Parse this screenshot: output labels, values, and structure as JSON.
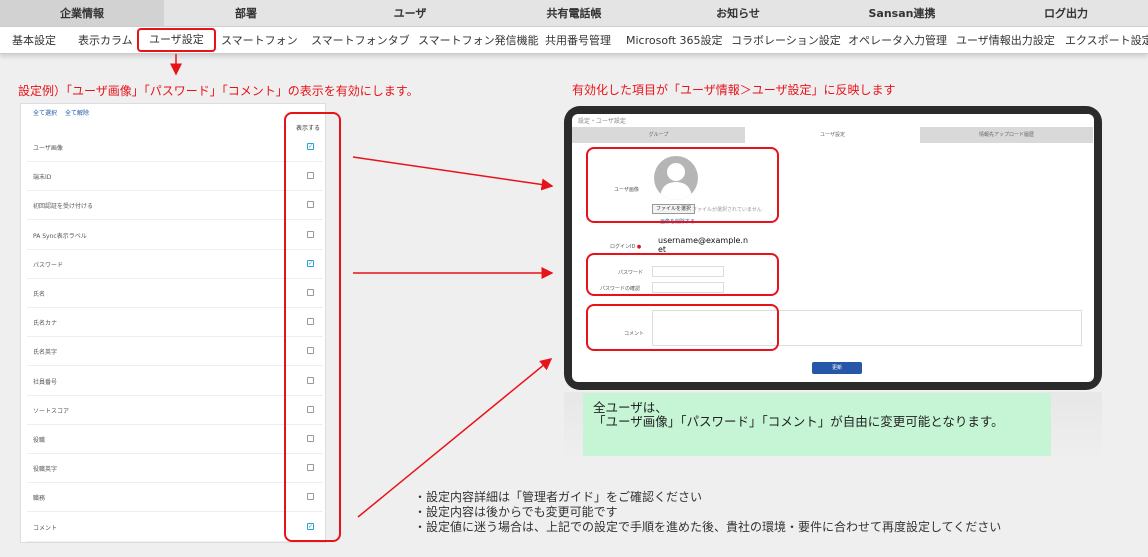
{
  "top_tabs": [
    "企業情報",
    "部署",
    "ユーザ",
    "共有電話帳",
    "お知らせ",
    "Sansan連携",
    "ログ出力"
  ],
  "sub_nav": [
    "基本設定",
    "表示カラム",
    "ユーザ設定",
    "スマートフォン",
    "スマートフォンタブ",
    "スマートフォン発信機能",
    "共用番号管理",
    "Microsoft 365設定",
    "コラボレーション設定",
    "オペレータ入力管理",
    "ユーザ情報出力設定",
    "エクスポート設定"
  ],
  "captions": {
    "left": "設定例）「ユーザ画像」「パスワード」「コメント」の表示を有効にします。",
    "right": "有効化した項目が「ユーザ情報＞ユーザ設定」に反映します"
  },
  "settings_panel": {
    "select_all": "全て選択",
    "clear_all": "全て解除",
    "column_header": "表示する",
    "rows": [
      {
        "label": "ユーザ画像",
        "checked": true
      },
      {
        "label": "端末ID",
        "checked": false
      },
      {
        "label": "初回認証を受け付ける",
        "checked": false
      },
      {
        "label": "PA Sync表示ラベル",
        "checked": false
      },
      {
        "label": "パスワード",
        "checked": true
      },
      {
        "label": "氏名",
        "checked": false
      },
      {
        "label": "氏名カナ",
        "checked": false
      },
      {
        "label": "氏名英字",
        "checked": false
      },
      {
        "label": "社員番号",
        "checked": false
      },
      {
        "label": "ソートスコア",
        "checked": false
      },
      {
        "label": "役職",
        "checked": false
      },
      {
        "label": "役職英字",
        "checked": false
      },
      {
        "label": "職務",
        "checked": false
      },
      {
        "label": "コメント",
        "checked": true
      }
    ]
  },
  "tablet": {
    "breadcrumb": "設定・ユーザ設定",
    "tabs": [
      "グループ",
      "ユーザ設定",
      "情報先アップロード履歴"
    ],
    "user_image_label": "ユーザ画像",
    "file_button": "ファイルを選択",
    "file_note": "ファイルが選択されていません",
    "delete_image": "画像を削除する",
    "login_id_label": "ログインID",
    "login_id_value": "username@example.net",
    "password_label": "パスワード",
    "password_confirm_label": "パスワードの確認",
    "comment_label": "コメント",
    "submit_label": "更新"
  },
  "green_note": "全ユーザは、\n「ユーザ画像」「パスワード」「コメント」が自由に変更可能となります。",
  "notes": [
    "・設定内容詳細は「管理者ガイド」をご確認ください",
    "・設定内容は後からでも変更可能です",
    "・設定値に迷う場合は、上記での設定で手順を進めた後、貴社の環境・要件に合わせて再度設定してください"
  ],
  "colors": {
    "accent_red": "#e8121a",
    "note_green": "#c6f5d6",
    "link_blue": "#1a5aa6"
  }
}
